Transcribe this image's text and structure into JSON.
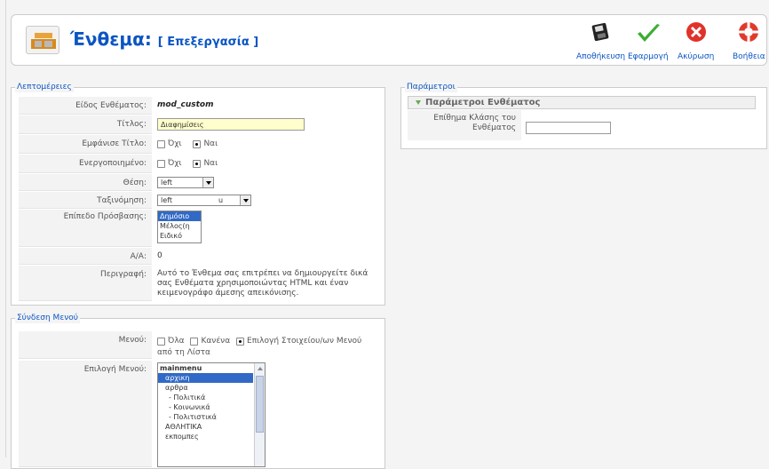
{
  "header": {
    "title": "Ένθεμα:",
    "subtitle": "[ Επεξεργασία ]",
    "toolbar": {
      "save": "Αποθήκευση",
      "apply": "Εφαρμογή",
      "cancel": "Ακύρωση",
      "help": "Βοήθεια"
    }
  },
  "details": {
    "legend": "Λεπτομέρειες",
    "module_type_label": "Είδος Ενθέματος:",
    "module_type_value": "mod_custom",
    "title_label": "Τίτλος:",
    "title_value": "Διαφημίσεις",
    "show_title_label": "Εμφάνισε Τίτλο:",
    "enabled_label": "Ενεργοποιημένο:",
    "no": "Όχι",
    "yes": "Ναι",
    "position_label": "Θέση:",
    "position_value": "left",
    "order_label": "Ταξινόμηση:",
    "order_value_1": "left",
    "order_value_2": "u",
    "access_label": "Επίπεδο Πρόσβασης:",
    "access_options": [
      "Δημόσιο",
      "Μέλος(η",
      "Ειδικό"
    ],
    "id_label": "Α/Α:",
    "id_value": "0",
    "description_label": "Περιγραφή:",
    "description_value": "Αυτό το Ένθεμα σας επιτρέπει να δημιουργείτε δικά σας Ενθέματα χρησιμοποιώντας HTML και έναν κειμενογράφο άμεσης απεικόνισης."
  },
  "menu_link": {
    "legend": "Σύνδεση Μενού",
    "menus_label": "Μενού:",
    "opt_all": "Όλα",
    "opt_none": "Κανένα",
    "opt_select": "Επιλογή Στοιχείου/ων Μενού από τη Λίστα",
    "select_label": "Επιλογή Μενού:",
    "items": [
      "mainmenu",
      "αρχικη",
      "αρθρα",
      "- Πολιτικά",
      "- Κοινωνικά",
      "- Πολιτιστικά",
      "ΑΘΛΗΤΙΚΑ",
      "εκπομπες"
    ]
  },
  "params": {
    "legend": "Παράμετροι",
    "section": "Παράμετροι Ενθέματος",
    "suffix_label": "Επίθημα Κλάσης του Ενθέματος",
    "suffix_value": ""
  }
}
